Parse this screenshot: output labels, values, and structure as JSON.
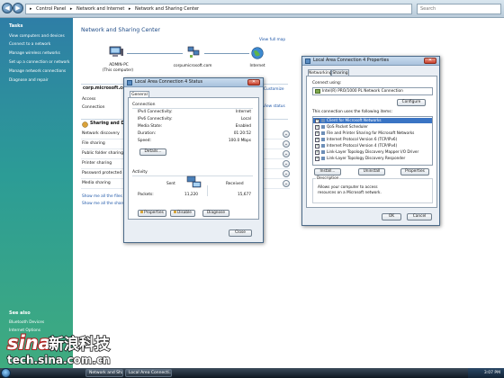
{
  "address_bar": {
    "crumbs": [
      "Control Panel",
      "Network and Internet",
      "Network and Sharing Center"
    ],
    "separator": "▸",
    "back_icon": "◀",
    "forward_icon": "▶",
    "search_placeholder": "Search"
  },
  "tasks_pane": {
    "title": "Tasks",
    "items": [
      "View computers and devices",
      "Connect to a network",
      "Manage wireless networks",
      "Set up a connection or network",
      "Manage network connections",
      "Diagnose and repair"
    ],
    "see_also_title": "See also",
    "see_also_items": [
      "Bluetooth Devices",
      "Internet Options"
    ]
  },
  "main": {
    "title": "Network and Sharing Center",
    "view_full_map": "View full map",
    "map": {
      "computer_label": "ADMIN-PC",
      "computer_sublabel": "(This computer)",
      "network_label": "corpumicrosoft.com",
      "internet_label": "Internet"
    },
    "network_name": "corp.microsoft.com",
    "customize": "Customize",
    "access_label": "Access",
    "connection_label": "Connection",
    "view_status": "View status",
    "sharing_title": "Sharing and Discovery",
    "sharing_rows": [
      "Network discovery",
      "File sharing",
      "Public folder sharing",
      "Printer sharing",
      "Password protected sharing",
      "Media sharing"
    ],
    "toggle_icon": "⌄",
    "bottom_links": [
      "Show me all the files and folders I am sharing",
      "Show me all the shared network folders on this computer"
    ]
  },
  "status_dialog": {
    "title": "Local Area Connection 4 Status",
    "close_icon": "✕",
    "tab": "General",
    "connection_group": "Connection",
    "rows": [
      {
        "label": "IPv4 Connectivity:",
        "value": "Internet"
      },
      {
        "label": "IPv6 Connectivity:",
        "value": "Local"
      },
      {
        "label": "Media State:",
        "value": "Enabled"
      },
      {
        "label": "Duration:",
        "value": "01:20:52"
      },
      {
        "label": "Speed:",
        "value": "100.0 Mbps"
      }
    ],
    "details_button": "Details...",
    "activity_group": "Activity",
    "sent_label": "Sent",
    "received_label": "Received",
    "packets_label": "Packets:",
    "packets_sent": "11,220",
    "packets_received": "15,677",
    "buttons": [
      "Properties",
      "Disable",
      "Diagnose"
    ],
    "close_button": "Close"
  },
  "props_dialog": {
    "title": "Local Area Connection 4 Properties",
    "close_icon": "✕",
    "tabs": [
      "Networking",
      "Sharing"
    ],
    "connect_using_label": "Connect using:",
    "adapter": "Intel(R) PRO/1000 PL Network Connection",
    "configure_button": "Configure",
    "items_label": "This connection uses the following items:",
    "check_mark": "✓",
    "items": [
      "Client for Microsoft Networks",
      "QoS Packet Scheduler",
      "File and Printer Sharing for Microsoft Networks",
      "Internet Protocol Version 6 (TCP/IPv6)",
      "Internet Protocol Version 4 (TCP/IPv4)",
      "Link-Layer Topology Discovery Mapper I/O Driver",
      "Link-Layer Topology Discovery Responder"
    ],
    "selected_item": 0,
    "action_buttons": [
      "Install...",
      "Uninstall",
      "Properties"
    ],
    "description_title": "Description",
    "description_text": "Allows your computer to access resources on a Microsoft network.",
    "ok_button": "OK",
    "cancel_button": "Cancel"
  },
  "taskbar": {
    "buttons": [
      "Network and Sharing Center",
      "Local Area Connecti..."
    ],
    "clock": "3:07 PM"
  },
  "watermark": {
    "brand": "sina新浪科技",
    "url": "tech.sina.com.cn"
  }
}
